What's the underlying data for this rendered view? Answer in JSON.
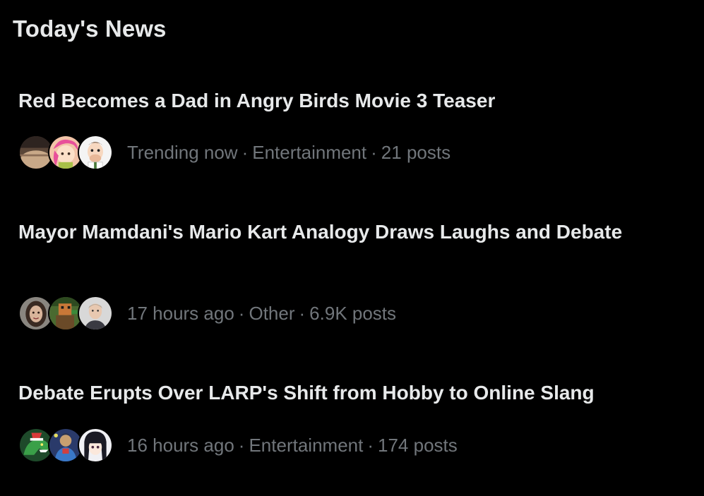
{
  "section": {
    "title": "Today's News"
  },
  "colors": {
    "background": "#000000",
    "headline": "#e7e9ea",
    "meta": "#71767b"
  },
  "news": [
    {
      "headline": "Red Becomes a Dad in Angry Birds Movie 3 Teaser",
      "time": "Trending now",
      "category": "Entertainment",
      "posts": "21 posts",
      "avatars": [
        "brown-photo-avatar",
        "cartoon-girl-avatar",
        "cartoon-man-avatar"
      ]
    },
    {
      "headline": "Mayor Mamdani's Mario Kart Analogy Draws Laughs and Debate",
      "time": "17 hours ago",
      "category": "Other",
      "posts": "6.9K posts",
      "avatars": [
        "woman-photo-avatar",
        "pixel-art-avatar",
        "man-photo-avatar"
      ]
    },
    {
      "headline": "Debate Erupts Over LARP's Shift from Hobby to Online Slang",
      "time": "16 hours ago",
      "category": "Entertainment",
      "posts": "174 posts",
      "avatars": [
        "green-dino-avatar",
        "armored-hero-avatar",
        "anime-girl-avatar"
      ]
    }
  ],
  "separator": "·"
}
